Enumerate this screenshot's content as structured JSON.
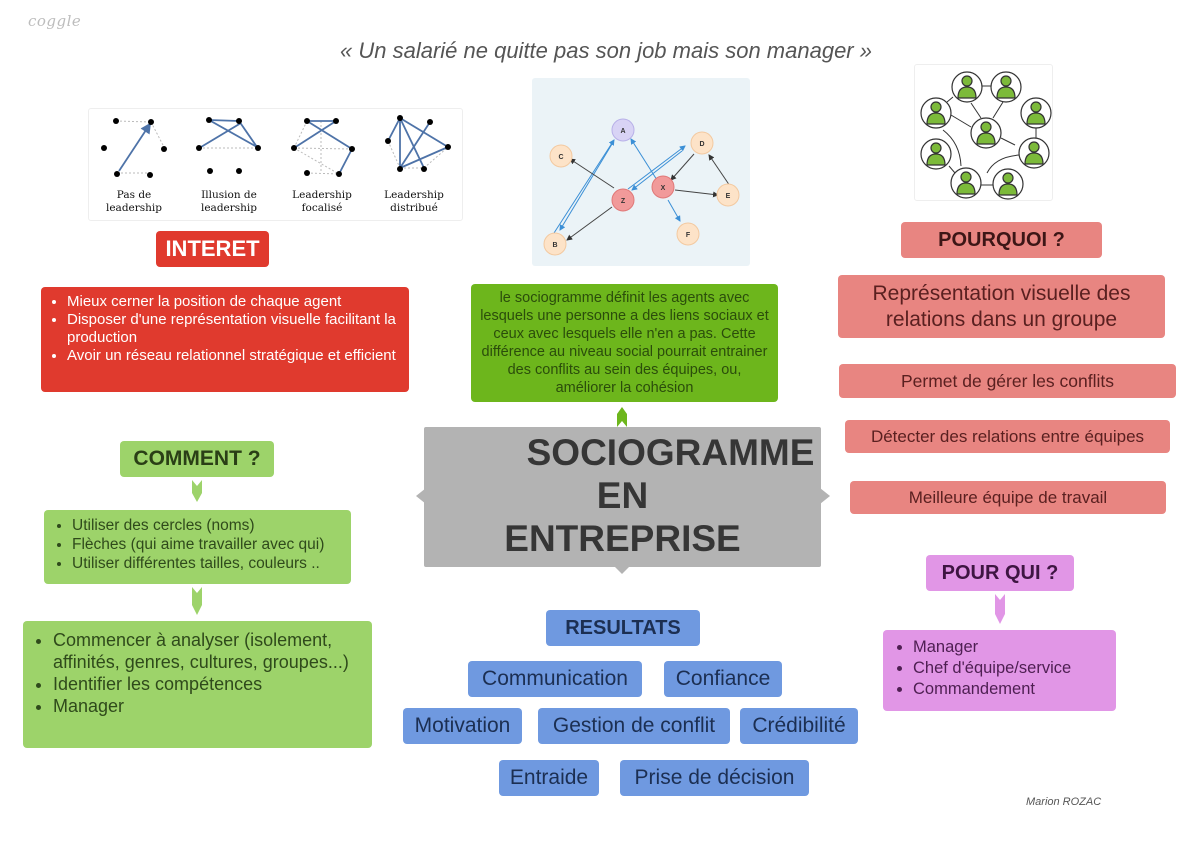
{
  "header": {
    "logo": "coggle",
    "quote": "« Un salarié ne quitte pas son job mais son manager »",
    "author": "Marion ROZAC"
  },
  "central": {
    "lines": [
      "SOCIOGRAMME",
      "EN",
      "ENTREPRISE"
    ]
  },
  "leadership_image": {
    "captions": [
      [
        "Pas de",
        "leadership"
      ],
      [
        "Illusion de",
        "leadership"
      ],
      [
        "Leadership",
        "focalisé"
      ],
      [
        "Leadership",
        "distribué"
      ]
    ]
  },
  "sociogram_image": {
    "nodes": [
      "A",
      "B",
      "C",
      "D",
      "E",
      "F",
      "X",
      "Z"
    ]
  },
  "interet": {
    "title": "INTERET",
    "items": [
      "Mieux cerner la position de chaque agent",
      "Disposer d'une représentation visuelle facilitant la production",
      "Avoir un réseau relationnel stratégique et efficient"
    ]
  },
  "definition": {
    "text": "le sociogramme définit les agents avec lesquels une personne a des liens sociaux et ceux avec lesquels elle n'en a pas. Cette différence au niveau social pourrait entrainer des conflits au sein des équipes, ou, améliorer la cohésion"
  },
  "comment": {
    "title": "COMMENT ?",
    "items": [
      "Utiliser des cercles (noms)",
      "Flèches (qui aime travailler avec qui)",
      "Utiliser différentes tailles, couleurs .."
    ],
    "next_items": [
      "Commencer à analyser (isolement, affinités, genres, cultures, groupes...)",
      "Identifier les compétences",
      "Manager"
    ]
  },
  "resultats": {
    "title": "RESULTATS",
    "items": [
      "Communication",
      "Confiance",
      "Motivation",
      "Gestion de conflit",
      "Crédibilité",
      "Entraide",
      "Prise de décision"
    ]
  },
  "pourquoi": {
    "title": "POURQUOI ?",
    "items": [
      "Représentation visuelle des relations dans un groupe",
      "Permet de gérer les conflits",
      "Détecter des relations entre équipes",
      "Meilleure équipe de travail"
    ]
  },
  "pour_qui": {
    "title": "POUR QUI ?",
    "items": [
      "Manager",
      "Chef d'équipe/service",
      "Commandement"
    ]
  },
  "colors": {
    "interet": "#e03a2e",
    "definition": "#6db61c",
    "comment": "#9dd36a",
    "central": "#b3b3b3",
    "resultats": "#6f99e0",
    "pourquoi": "#e88581",
    "pour_qui": "#e196e6"
  }
}
